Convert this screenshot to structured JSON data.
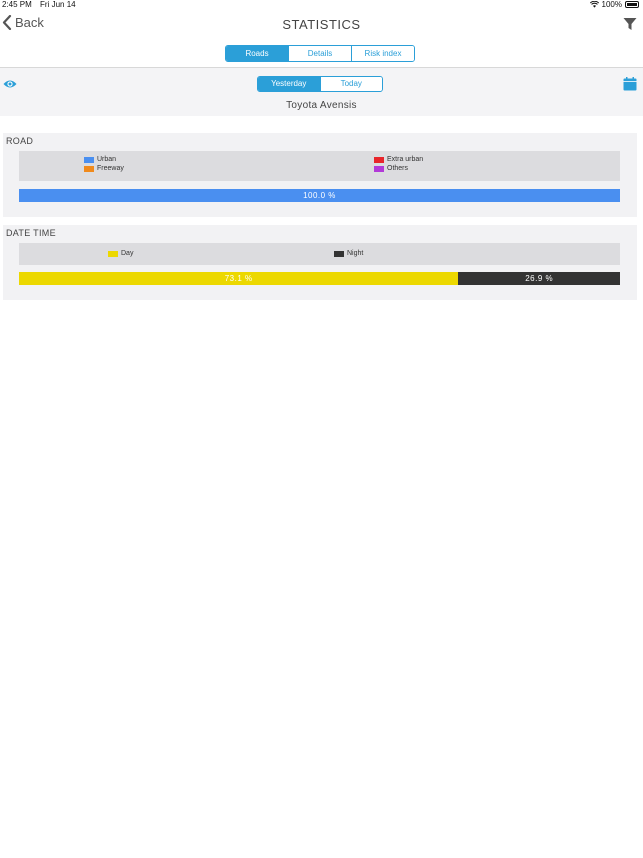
{
  "status_bar": {
    "time": "2:45 PM",
    "date": "Fri Jun 14",
    "battery": "100%"
  },
  "nav": {
    "back_label": "Back",
    "title": "STATISTICS"
  },
  "top_tabs": [
    {
      "label": "Roads",
      "active": true
    },
    {
      "label": "Details",
      "active": false
    },
    {
      "label": "Risk index",
      "active": false
    }
  ],
  "day_tabs": [
    {
      "label": "Yesterday",
      "active": true
    },
    {
      "label": "Today",
      "active": false
    }
  ],
  "vehicle": "Toyota Avensis",
  "road": {
    "title": "ROAD",
    "legend": [
      {
        "label": "Urban",
        "color": "#4a8ff0"
      },
      {
        "label": "Extra urban",
        "color": "#e8252b"
      },
      {
        "label": "Freeway",
        "color": "#f08a1c"
      },
      {
        "label": "Others",
        "color": "#b23ad8"
      }
    ],
    "bar": [
      {
        "label": "100.0 %",
        "value": 100.0,
        "color": "#4a8ff0"
      }
    ]
  },
  "date_time": {
    "title": "DATE TIME",
    "legend": [
      {
        "label": "Day",
        "color": "#ecd800"
      },
      {
        "label": "Night",
        "color": "#333333"
      }
    ],
    "bar": [
      {
        "label": "73.1 %",
        "value": 73.1,
        "color": "#ecd800"
      },
      {
        "label": "26.9 %",
        "value": 26.9,
        "color": "#333333"
      }
    ]
  }
}
